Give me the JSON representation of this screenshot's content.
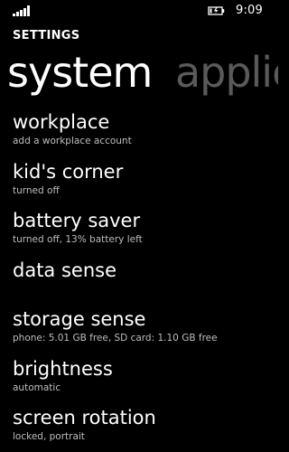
{
  "status_bar": {
    "time": "9:09",
    "signal_icon": "signal-bars-icon",
    "battery_icon": "battery-charging-icon"
  },
  "header": {
    "section_title": "SETTINGS",
    "pivot_active": "system",
    "pivot_next": "applicat"
  },
  "settings": {
    "items": [
      {
        "title": "workplace",
        "subtitle": "add a workplace account"
      },
      {
        "title": "kid's corner",
        "subtitle": "turned off"
      },
      {
        "title": "battery saver",
        "subtitle": "turned off, 13% battery left"
      },
      {
        "title": "data sense",
        "subtitle": ""
      },
      {
        "title": "storage sense",
        "subtitle": "phone: 5.01 GB free, SD card: 1.10 GB free"
      },
      {
        "title": "brightness",
        "subtitle": "automatic"
      },
      {
        "title": "screen rotation",
        "subtitle": "locked, portrait"
      }
    ]
  }
}
